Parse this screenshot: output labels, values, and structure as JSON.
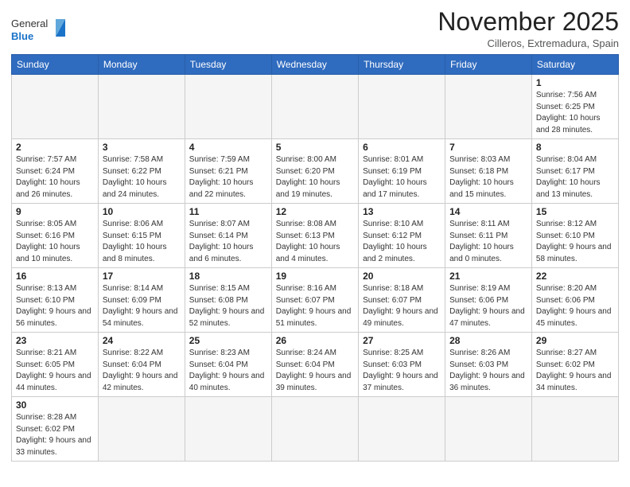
{
  "logo": {
    "general": "General",
    "blue": "Blue"
  },
  "title": "November 2025",
  "subtitle": "Cilleros, Extremadura, Spain",
  "days_of_week": [
    "Sunday",
    "Monday",
    "Tuesday",
    "Wednesday",
    "Thursday",
    "Friday",
    "Saturday"
  ],
  "weeks": [
    [
      {
        "day": "",
        "info": ""
      },
      {
        "day": "",
        "info": ""
      },
      {
        "day": "",
        "info": ""
      },
      {
        "day": "",
        "info": ""
      },
      {
        "day": "",
        "info": ""
      },
      {
        "day": "",
        "info": ""
      },
      {
        "day": "1",
        "info": "Sunrise: 7:56 AM\nSunset: 6:25 PM\nDaylight: 10 hours and 28 minutes."
      }
    ],
    [
      {
        "day": "2",
        "info": "Sunrise: 7:57 AM\nSunset: 6:24 PM\nDaylight: 10 hours and 26 minutes."
      },
      {
        "day": "3",
        "info": "Sunrise: 7:58 AM\nSunset: 6:22 PM\nDaylight: 10 hours and 24 minutes."
      },
      {
        "day": "4",
        "info": "Sunrise: 7:59 AM\nSunset: 6:21 PM\nDaylight: 10 hours and 22 minutes."
      },
      {
        "day": "5",
        "info": "Sunrise: 8:00 AM\nSunset: 6:20 PM\nDaylight: 10 hours and 19 minutes."
      },
      {
        "day": "6",
        "info": "Sunrise: 8:01 AM\nSunset: 6:19 PM\nDaylight: 10 hours and 17 minutes."
      },
      {
        "day": "7",
        "info": "Sunrise: 8:03 AM\nSunset: 6:18 PM\nDaylight: 10 hours and 15 minutes."
      },
      {
        "day": "8",
        "info": "Sunrise: 8:04 AM\nSunset: 6:17 PM\nDaylight: 10 hours and 13 minutes."
      }
    ],
    [
      {
        "day": "9",
        "info": "Sunrise: 8:05 AM\nSunset: 6:16 PM\nDaylight: 10 hours and 10 minutes."
      },
      {
        "day": "10",
        "info": "Sunrise: 8:06 AM\nSunset: 6:15 PM\nDaylight: 10 hours and 8 minutes."
      },
      {
        "day": "11",
        "info": "Sunrise: 8:07 AM\nSunset: 6:14 PM\nDaylight: 10 hours and 6 minutes."
      },
      {
        "day": "12",
        "info": "Sunrise: 8:08 AM\nSunset: 6:13 PM\nDaylight: 10 hours and 4 minutes."
      },
      {
        "day": "13",
        "info": "Sunrise: 8:10 AM\nSunset: 6:12 PM\nDaylight: 10 hours and 2 minutes."
      },
      {
        "day": "14",
        "info": "Sunrise: 8:11 AM\nSunset: 6:11 PM\nDaylight: 10 hours and 0 minutes."
      },
      {
        "day": "15",
        "info": "Sunrise: 8:12 AM\nSunset: 6:10 PM\nDaylight: 9 hours and 58 minutes."
      }
    ],
    [
      {
        "day": "16",
        "info": "Sunrise: 8:13 AM\nSunset: 6:10 PM\nDaylight: 9 hours and 56 minutes."
      },
      {
        "day": "17",
        "info": "Sunrise: 8:14 AM\nSunset: 6:09 PM\nDaylight: 9 hours and 54 minutes."
      },
      {
        "day": "18",
        "info": "Sunrise: 8:15 AM\nSunset: 6:08 PM\nDaylight: 9 hours and 52 minutes."
      },
      {
        "day": "19",
        "info": "Sunrise: 8:16 AM\nSunset: 6:07 PM\nDaylight: 9 hours and 51 minutes."
      },
      {
        "day": "20",
        "info": "Sunrise: 8:18 AM\nSunset: 6:07 PM\nDaylight: 9 hours and 49 minutes."
      },
      {
        "day": "21",
        "info": "Sunrise: 8:19 AM\nSunset: 6:06 PM\nDaylight: 9 hours and 47 minutes."
      },
      {
        "day": "22",
        "info": "Sunrise: 8:20 AM\nSunset: 6:06 PM\nDaylight: 9 hours and 45 minutes."
      }
    ],
    [
      {
        "day": "23",
        "info": "Sunrise: 8:21 AM\nSunset: 6:05 PM\nDaylight: 9 hours and 44 minutes."
      },
      {
        "day": "24",
        "info": "Sunrise: 8:22 AM\nSunset: 6:04 PM\nDaylight: 9 hours and 42 minutes."
      },
      {
        "day": "25",
        "info": "Sunrise: 8:23 AM\nSunset: 6:04 PM\nDaylight: 9 hours and 40 minutes."
      },
      {
        "day": "26",
        "info": "Sunrise: 8:24 AM\nSunset: 6:04 PM\nDaylight: 9 hours and 39 minutes."
      },
      {
        "day": "27",
        "info": "Sunrise: 8:25 AM\nSunset: 6:03 PM\nDaylight: 9 hours and 37 minutes."
      },
      {
        "day": "28",
        "info": "Sunrise: 8:26 AM\nSunset: 6:03 PM\nDaylight: 9 hours and 36 minutes."
      },
      {
        "day": "29",
        "info": "Sunrise: 8:27 AM\nSunset: 6:02 PM\nDaylight: 9 hours and 34 minutes."
      }
    ],
    [
      {
        "day": "30",
        "info": "Sunrise: 8:28 AM\nSunset: 6:02 PM\nDaylight: 9 hours and 33 minutes."
      },
      {
        "day": "",
        "info": ""
      },
      {
        "day": "",
        "info": ""
      },
      {
        "day": "",
        "info": ""
      },
      {
        "day": "",
        "info": ""
      },
      {
        "day": "",
        "info": ""
      },
      {
        "day": "",
        "info": ""
      }
    ]
  ]
}
